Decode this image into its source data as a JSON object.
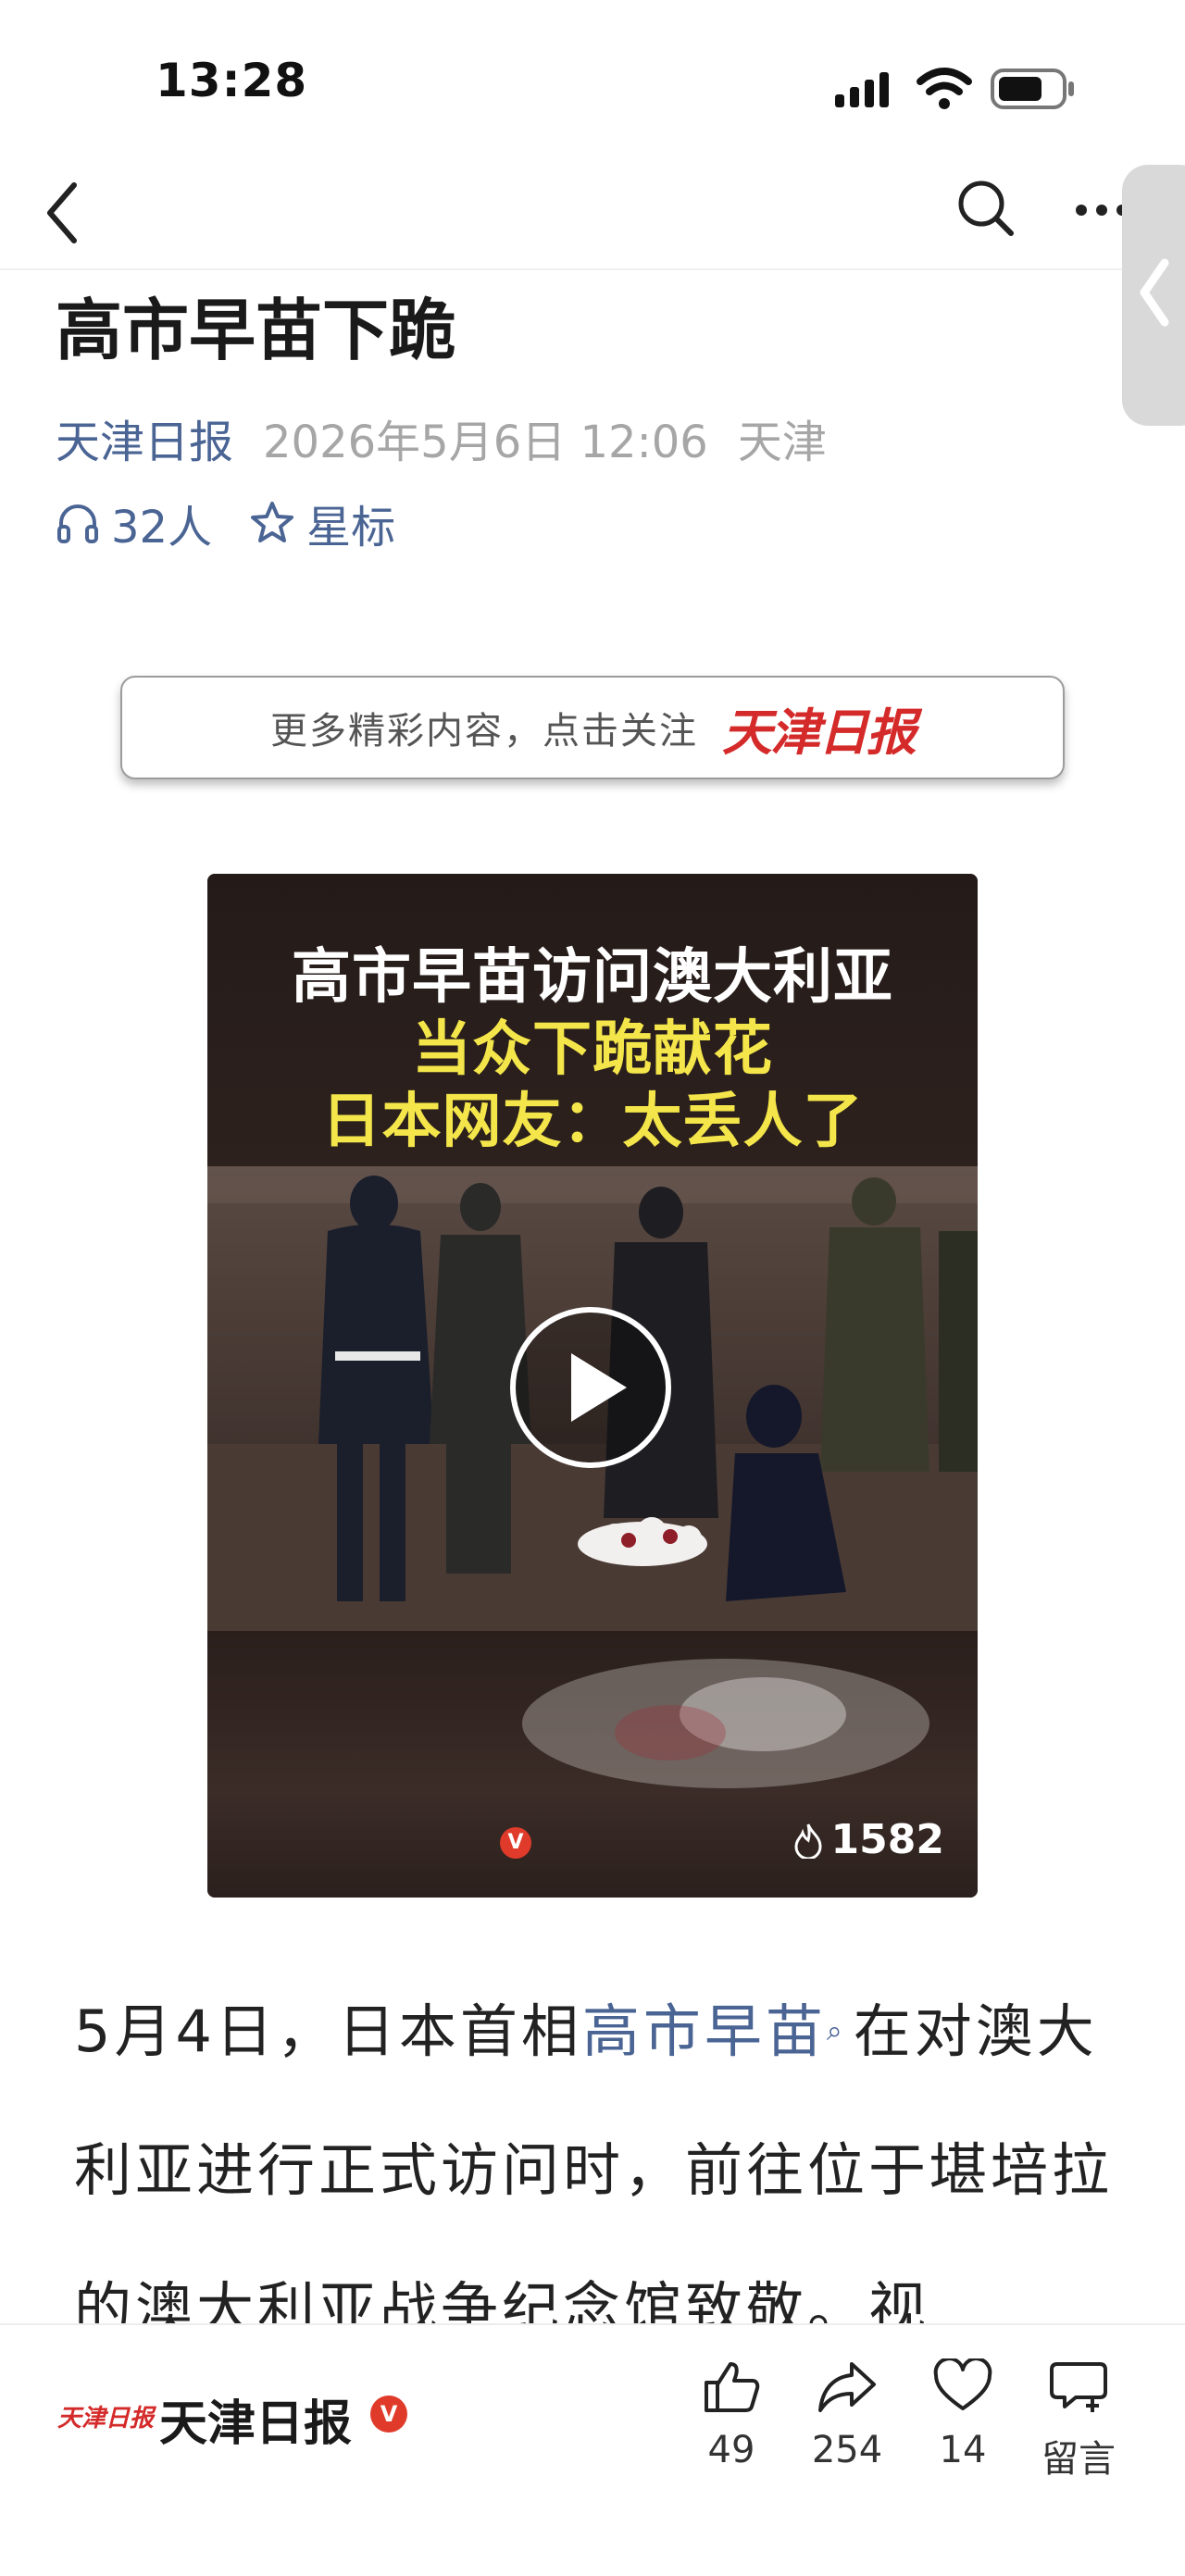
{
  "status_bar": {
    "time": "13:28",
    "icons": [
      "signal-icon",
      "wifi-icon",
      "battery-icon"
    ]
  },
  "nav": {
    "back_icon": "chevron-left-icon",
    "search_icon": "search-icon",
    "more_icon": "more-icon"
  },
  "article": {
    "title": "高市早苗下跪",
    "source": "天津日报",
    "date": "2026年5月6日 12:06",
    "location": "天津",
    "listeners": "32人",
    "star_label": "星标"
  },
  "follow_banner": {
    "text": "更多精彩内容，点击关注",
    "logo_text": "天津日报"
  },
  "video": {
    "caption_line1": "高市早苗访问澳大利亚",
    "caption_line2": "当众下跪献花",
    "caption_line3": "日本网友：太丢人了",
    "badge": "V",
    "hot_count": "1582"
  },
  "body": {
    "p1_part1": "5月4日，日本首相",
    "p1_link": "高市早苗",
    "p1_part2": "在对澳大利亚进行正式访问时，前往位于堪培拉的澳大利亚战争纪念馆致敬。视"
  },
  "bottom_bar": {
    "account_logo": "天津日报",
    "account_name": "天津日报",
    "verified_badge": "V",
    "likes": "49",
    "shares": "254",
    "favorites": "14",
    "comment_label": "留言"
  },
  "colors": {
    "accent_blue": "#4a6494",
    "brand_red": "#d42a2a",
    "caption_yellow": "#f4e64a",
    "meta_gray": "#a6a6a6"
  }
}
